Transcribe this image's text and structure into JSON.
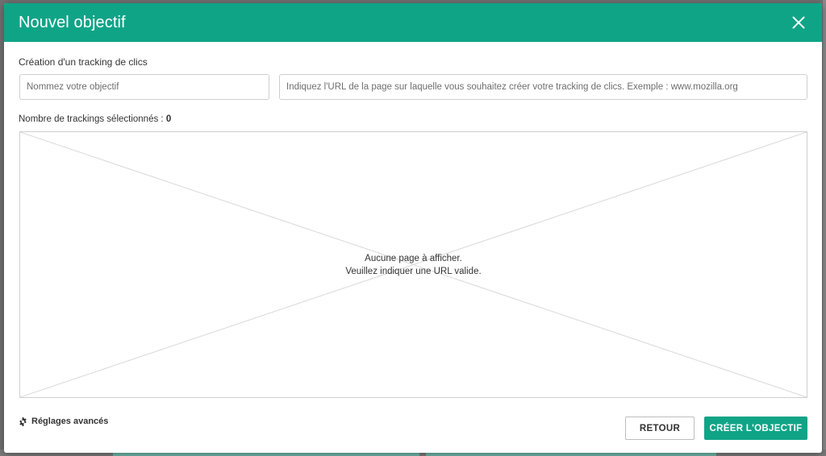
{
  "colors": {
    "accent": "#10a487",
    "overlay": "#6f6f6f"
  },
  "modal": {
    "title": "Nouvel objectif",
    "close_icon": "close-icon"
  },
  "form": {
    "section_label": "Création d'un tracking de clics",
    "name_placeholder": "Nommez votre objectif",
    "url_placeholder": "Indiquez l'URL de la page sur laquelle vous souhaitez créer votre tracking de clics. Exemple : www.mozilla.org",
    "count_label": "Nombre de trackings sélectionnés : ",
    "count_value": "0"
  },
  "preview": {
    "line1": "Aucune page à afficher.",
    "line2": "Veuillez indiquer une URL valide."
  },
  "footer": {
    "settings_label": "Réglages avancés",
    "settings_icon": "gear-icon",
    "back_label": "RETOUR",
    "create_label": "CRÉER L'OBJECTIF"
  }
}
